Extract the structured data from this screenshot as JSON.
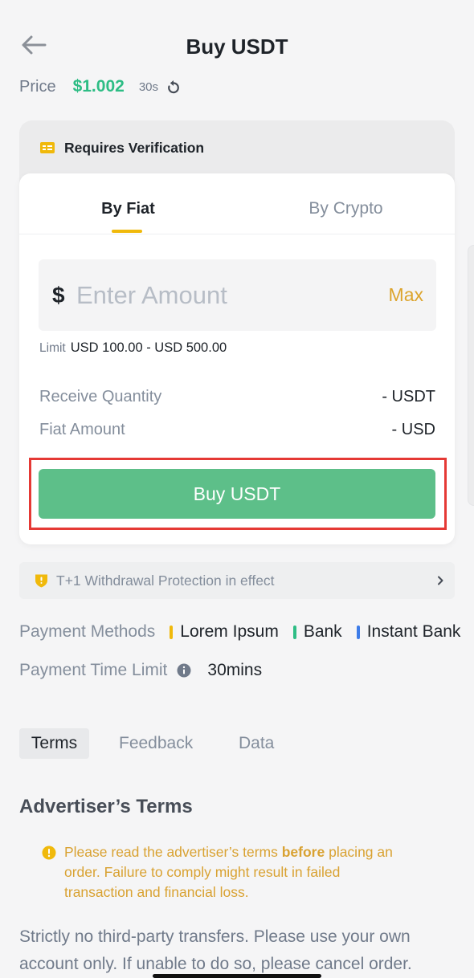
{
  "header": {
    "title": "Buy USDT",
    "back_icon": "arrow-left-icon"
  },
  "price": {
    "label": "Price",
    "value": "$1.002",
    "countdown": "30s",
    "refresh_icon": "refresh-icon"
  },
  "verification": {
    "label": "Requires Verification",
    "icon": "id-card-icon"
  },
  "trade_form": {
    "tabs": [
      {
        "label": "By Fiat",
        "active": true
      },
      {
        "label": "By Crypto",
        "active": false
      }
    ],
    "amount_input": {
      "currency_symbol": "$",
      "placeholder": "Enter Amount",
      "max_label": "Max"
    },
    "limit": {
      "label": "Limit",
      "value": "USD 100.00 - USD 500.00"
    },
    "summary": [
      {
        "label": "Receive Quantity",
        "value": "- USDT"
      },
      {
        "label": "Fiat Amount",
        "value": "- USD"
      }
    ],
    "submit_label": "Buy USDT"
  },
  "protection": {
    "text": "T+1 Withdrawal Protection in effect",
    "icon": "shield-icon",
    "chevron_icon": "chevron-right-icon"
  },
  "payment_methods": {
    "label": "Payment Methods",
    "methods": [
      {
        "name": "Lorem Ipsum",
        "color": "#f0b90b"
      },
      {
        "name": "Bank",
        "color": "#2ebd85"
      },
      {
        "name": "Instant Bank",
        "color": "#3d7ce8"
      }
    ]
  },
  "payment_time_limit": {
    "label": "Payment Time Limit",
    "value": "30mins",
    "icon": "info-icon"
  },
  "detail_tabs": [
    {
      "label": "Terms",
      "active": true
    },
    {
      "label": "Feedback",
      "active": false
    },
    {
      "label": "Data",
      "active": false
    }
  ],
  "advertiser_terms": {
    "heading": "Advertiser’s Terms",
    "notice": {
      "icon": "exclamation-circle-icon",
      "text_before": "Please read the advertiser’s terms ",
      "text_bold": "before",
      "text_after": " placing an order. Failure to comply might result in failed transaction and financial loss."
    },
    "body": "Strictly no third-party transfers. Please use your own account only. If unable to do so, please cancel order."
  },
  "theme": {
    "accent": "#f0b90b",
    "buy_green": "#5dbf89",
    "price_green": "#2ebd85",
    "highlight_outline": "#e53935"
  }
}
